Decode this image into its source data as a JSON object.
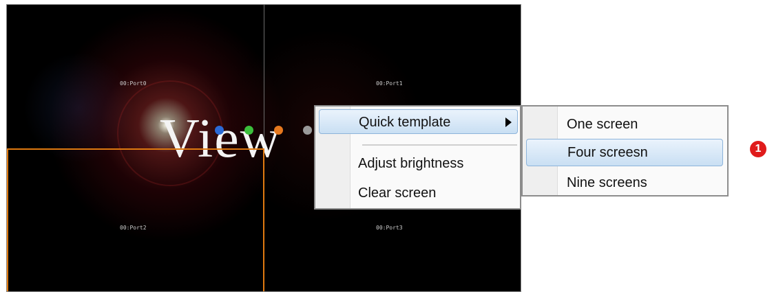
{
  "wall": {
    "ports": [
      "00:Port0",
      "00:Port1",
      "00:Port2",
      "00:Port3"
    ],
    "logo_text": "View",
    "dot_colors": [
      "#2b6ad6",
      "#3cbf3c",
      "#e6781e",
      "#9a9a9a"
    ],
    "selected_region_color": "#e07a10"
  },
  "context_menu": {
    "items": [
      {
        "label": "Quick template",
        "has_submenu": true,
        "highlighted": true
      },
      {
        "label": "Adjust brightness"
      },
      {
        "label": "Clear screen"
      }
    ]
  },
  "submenu": {
    "items": [
      {
        "label": "One screen"
      },
      {
        "label": "Four screesn",
        "highlighted": true
      },
      {
        "label": "Nine screens"
      }
    ]
  },
  "callout": {
    "number": "1",
    "color": "#e01b1b"
  }
}
